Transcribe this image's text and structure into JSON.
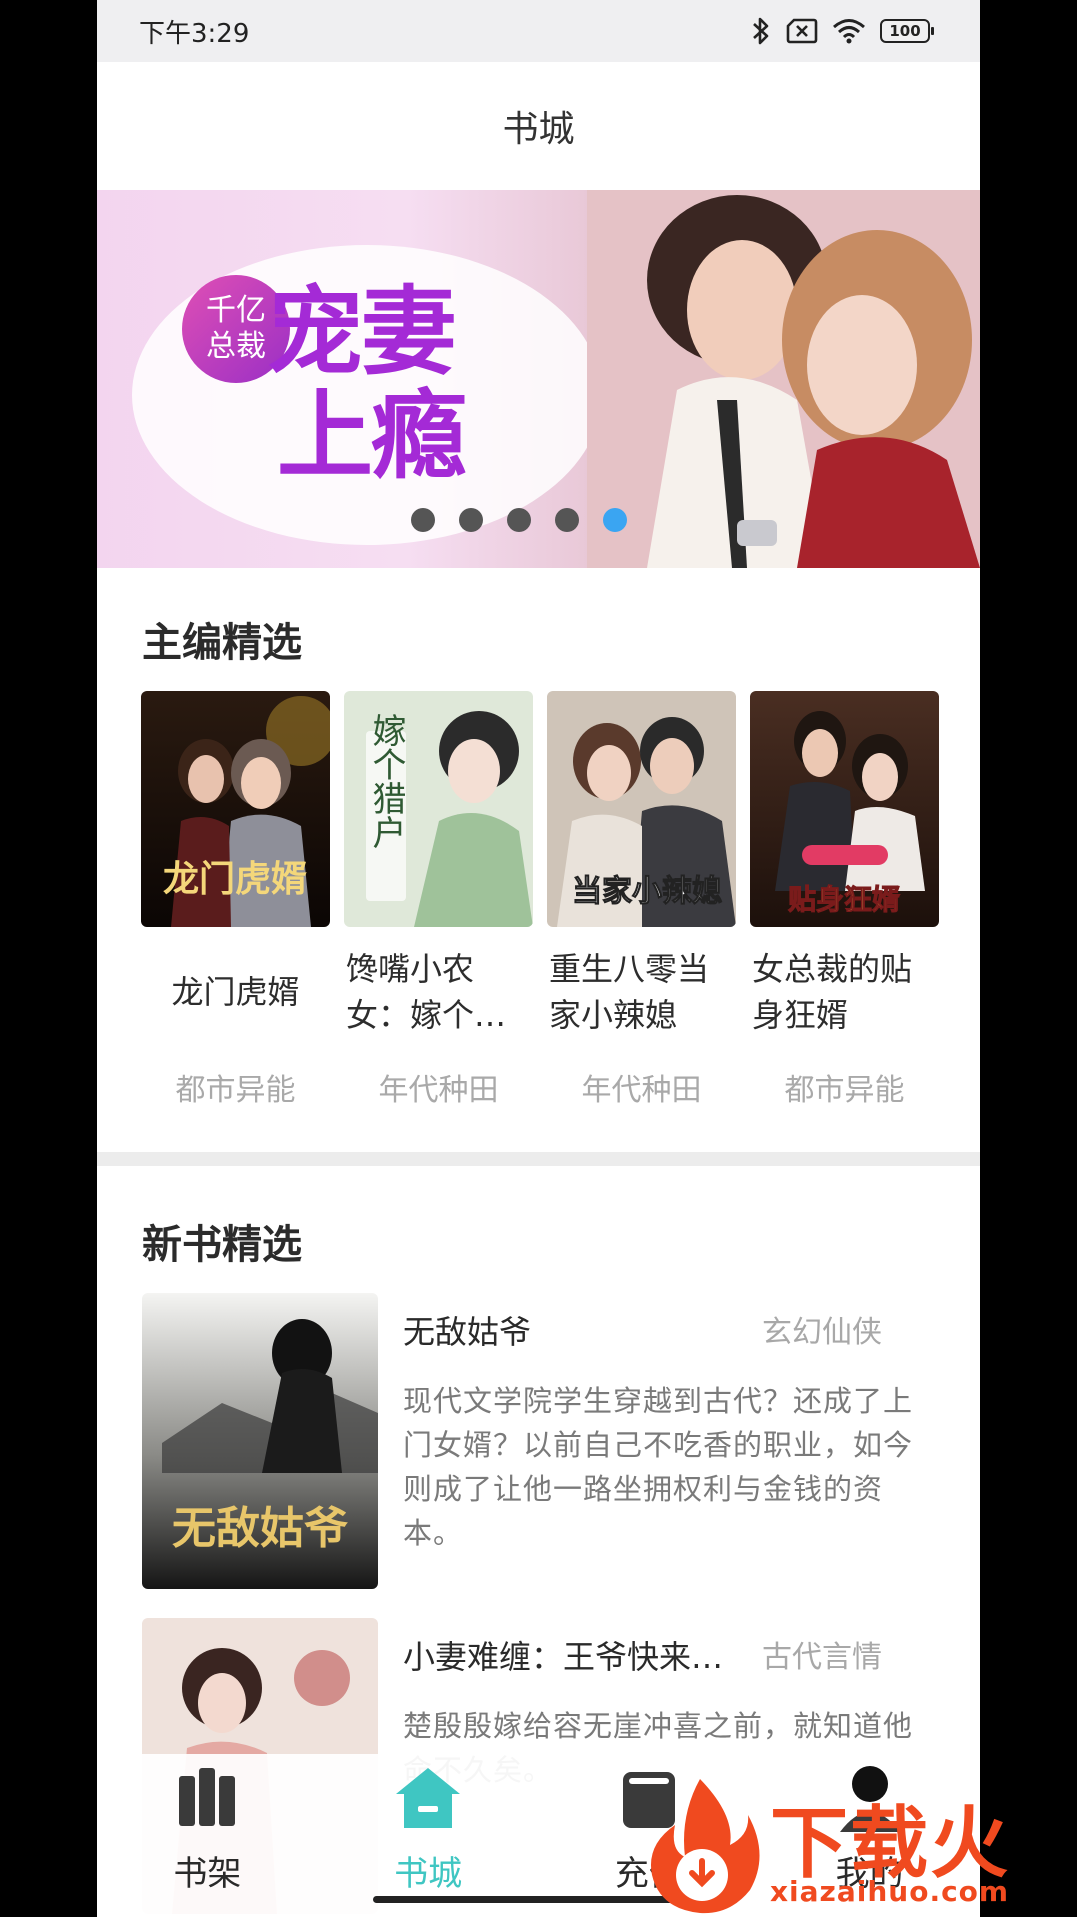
{
  "status_bar": {
    "time": "下午3:29",
    "battery": "100"
  },
  "header": {
    "title": "书城"
  },
  "banner": {
    "badge": [
      "千亿",
      "总裁"
    ],
    "title_lines": [
      "宠妻",
      "上瘾"
    ],
    "slide_count": 5,
    "active_slide": 5
  },
  "editor_picks": {
    "heading": "主编精选",
    "books": [
      {
        "title": "龙门虎婿",
        "title_lines": [
          "龙门虎婿"
        ],
        "category": "都市异能",
        "cover_text": "龙门虎婿"
      },
      {
        "title": "馋嘴小农女：嫁个…",
        "title_lines": [
          "馋嘴小农",
          "女：嫁个…"
        ],
        "category": "年代种田",
        "cover_text": "嫁个猎户"
      },
      {
        "title": "重生八零当家小辣媳",
        "title_lines": [
          "重生八零当",
          "家小辣媳"
        ],
        "category": "年代种田",
        "cover_text": "当家小辣媳"
      },
      {
        "title": "女总裁的贴身狂婿",
        "title_lines": [
          "女总裁的贴",
          "身狂婿"
        ],
        "category": "都市异能",
        "cover_text": "贴身狂婿"
      }
    ]
  },
  "new_books": {
    "heading": "新书精选",
    "books": [
      {
        "title": "无敌姑爷",
        "category": "玄幻仙侠",
        "description": "现代文学院学生穿越到古代？还成了上门女婿？以前自己不吃香的职业，如今则成了让他一路坐拥权利与金钱的资本。",
        "cover_text": "无敌姑爷"
      },
      {
        "title": "小妻难缠：王爷快来…",
        "category": "古代言情",
        "description": "楚殷殷嫁给容无崖冲喜之前，就知道他命不久矣。",
        "cover_text": ""
      }
    ]
  },
  "bottom_nav": {
    "items": [
      {
        "label": "书架",
        "icon": "bookshelf-icon"
      },
      {
        "label": "书城",
        "icon": "home-icon"
      },
      {
        "label": "充值",
        "icon": "recharge-icon"
      },
      {
        "label": "我的",
        "icon": "profile-icon"
      }
    ],
    "active_index": 1
  },
  "watermark": {
    "text": "下载火",
    "url": "xiazaihuo.com"
  },
  "colors": {
    "accent": "#3fc6c2",
    "dot_active": "#3aa5f2",
    "watermark": "#f04a1f"
  }
}
